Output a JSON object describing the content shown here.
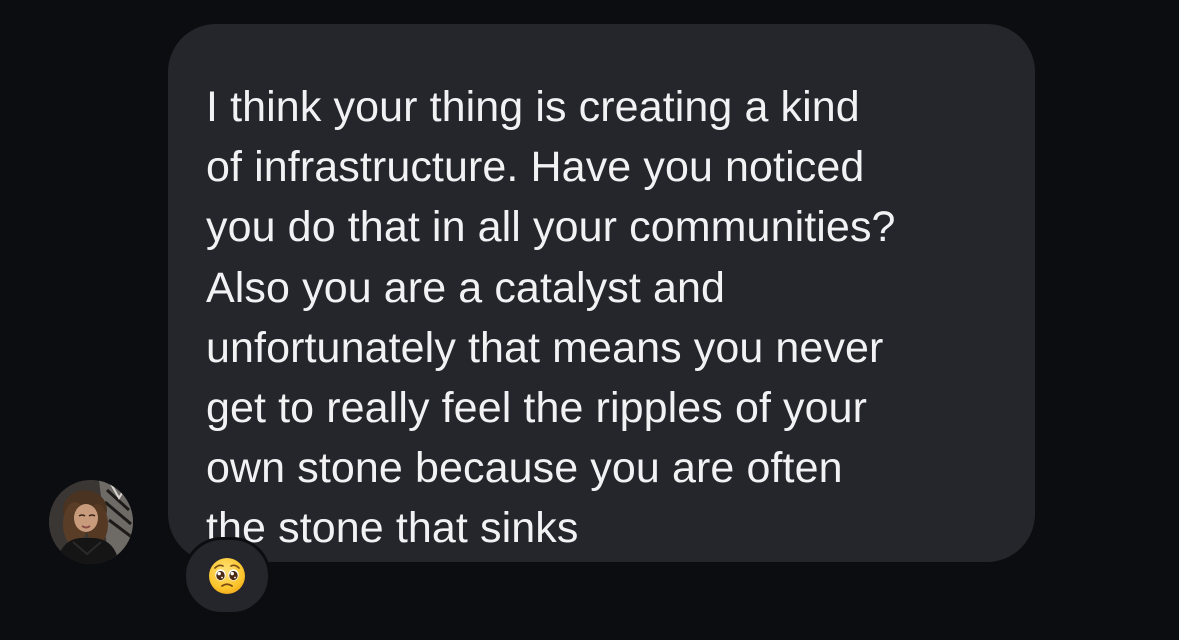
{
  "message": {
    "lines": [
      "I think your thing is creating a kind",
      "of infrastructure. Have you noticed",
      "you do that in all your communities?",
      "Also you are a catalyst and",
      "unfortunately that means you never",
      "get to really feel the ripples of your",
      "own stone because you are often",
      "the stone that sinks"
    ]
  },
  "reaction": {
    "emoji": "pleading-face-icon"
  },
  "colors": {
    "background": "#0c0d11",
    "bubble": "#25262b",
    "text": "#f2f2f4"
  }
}
